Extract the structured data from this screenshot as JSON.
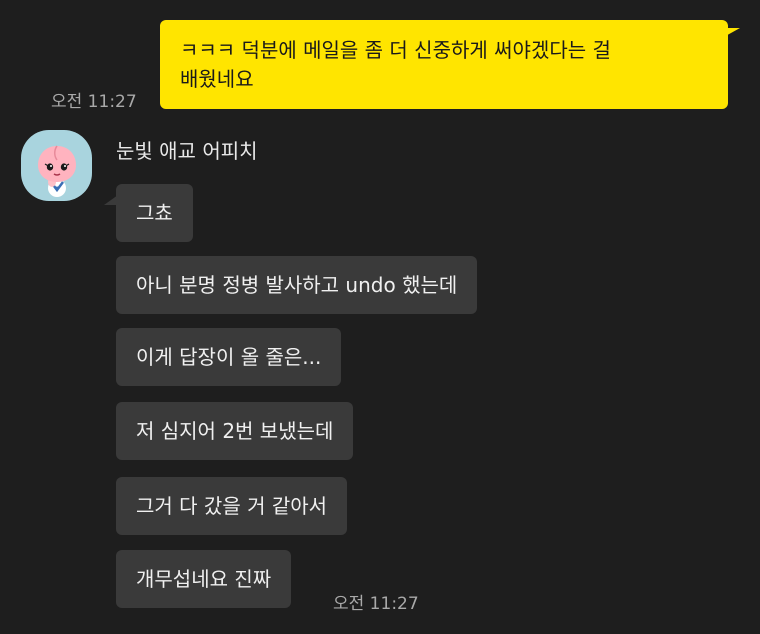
{
  "outgoing": {
    "message": "ㅋㅋㅋ 덕분에 메일을 좀 더 신중하게 써야겠다는 걸\n배웠네요",
    "time": "오전 11:27"
  },
  "incoming": {
    "sender_name": "눈빛 애교 어피치",
    "avatar_icon": "peach-character-icon",
    "messages": [
      "그쵸",
      "아니 분명 정병 발사하고 undo 했는데",
      "이게 답장이 올 줄은...",
      "저 심지어 2번 보냈는데",
      "그거 다 갔을 거 같아서",
      "개무섭네요 진짜"
    ],
    "time": "오전 11:27"
  },
  "colors": {
    "background": "#1e1e1e",
    "outgoing_bubble": "#ffe500",
    "incoming_bubble": "#3a3a3a",
    "timestamp": "#a9a9a9"
  }
}
